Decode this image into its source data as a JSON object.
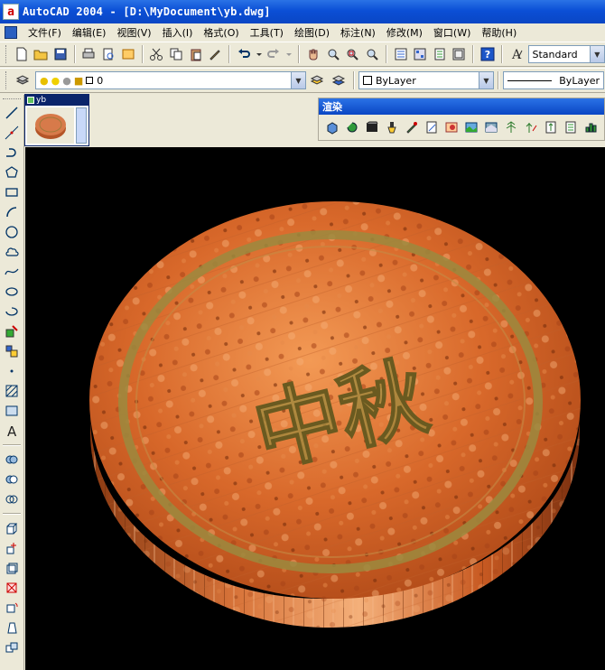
{
  "window": {
    "title": "AutoCAD 2004 - [D:\\MyDocument\\yb.dwg]",
    "app_icon_letter": "a"
  },
  "menu": {
    "items": [
      {
        "label": "文件(F)"
      },
      {
        "label": "编辑(E)"
      },
      {
        "label": "视图(V)"
      },
      {
        "label": "插入(I)"
      },
      {
        "label": "格式(O)"
      },
      {
        "label": "工具(T)"
      },
      {
        "label": "绘图(D)"
      },
      {
        "label": "标注(N)"
      },
      {
        "label": "修改(M)"
      },
      {
        "label": "窗口(W)"
      },
      {
        "label": "帮助(H)"
      }
    ]
  },
  "standard_toolbar": {
    "text_style_value": "Standard"
  },
  "layers_toolbar": {
    "layer_value": "0",
    "color_value": "ByLayer",
    "linetype_value": "ByLayer"
  },
  "document": {
    "tab_label": "yb"
  },
  "render_toolbar": {
    "title": "渲染"
  },
  "drawing": {
    "text": "中秋",
    "colors": {
      "background": "#000000",
      "body": "#d76a2c",
      "ring": "#a08a3a"
    }
  }
}
